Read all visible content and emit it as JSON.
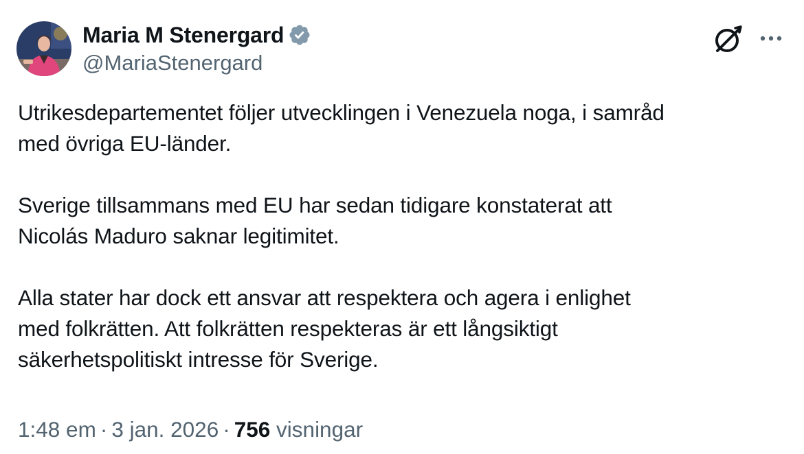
{
  "author": {
    "display_name": "Maria M Stenergard",
    "handle": "@MariaStenergard",
    "verified": true,
    "verified_color": "#829aab"
  },
  "icons": {
    "grok": "grok-icon",
    "more": "more-options-icon",
    "verified": "verified-badge-icon"
  },
  "tweet": {
    "paragraphs": [
      [
        "Utrikesdepartementet följer utvecklingen i Venezuela noga, i samråd",
        "med övriga EU-länder."
      ],
      [
        "Sverige tillsammans med EU har sedan tidigare konstaterat att",
        "Nicolás Maduro saknar legitimitet."
      ],
      [
        "Alla stater har dock ett ansvar att respektera och agera i enlighet",
        "med folkrätten. Att folkrätten respekteras är ett långsiktigt",
        "säkerhetspolitiskt intresse för Sverige."
      ]
    ]
  },
  "meta": {
    "time": "1:48 em",
    "separator": "·",
    "date": "3 jan. 2026",
    "views_count": "756",
    "views_label": "visningar"
  },
  "colors": {
    "text": "#0f1419",
    "secondary": "#536471",
    "avatar_jacket": "#e0457b",
    "avatar_background": "#2a3d66"
  }
}
